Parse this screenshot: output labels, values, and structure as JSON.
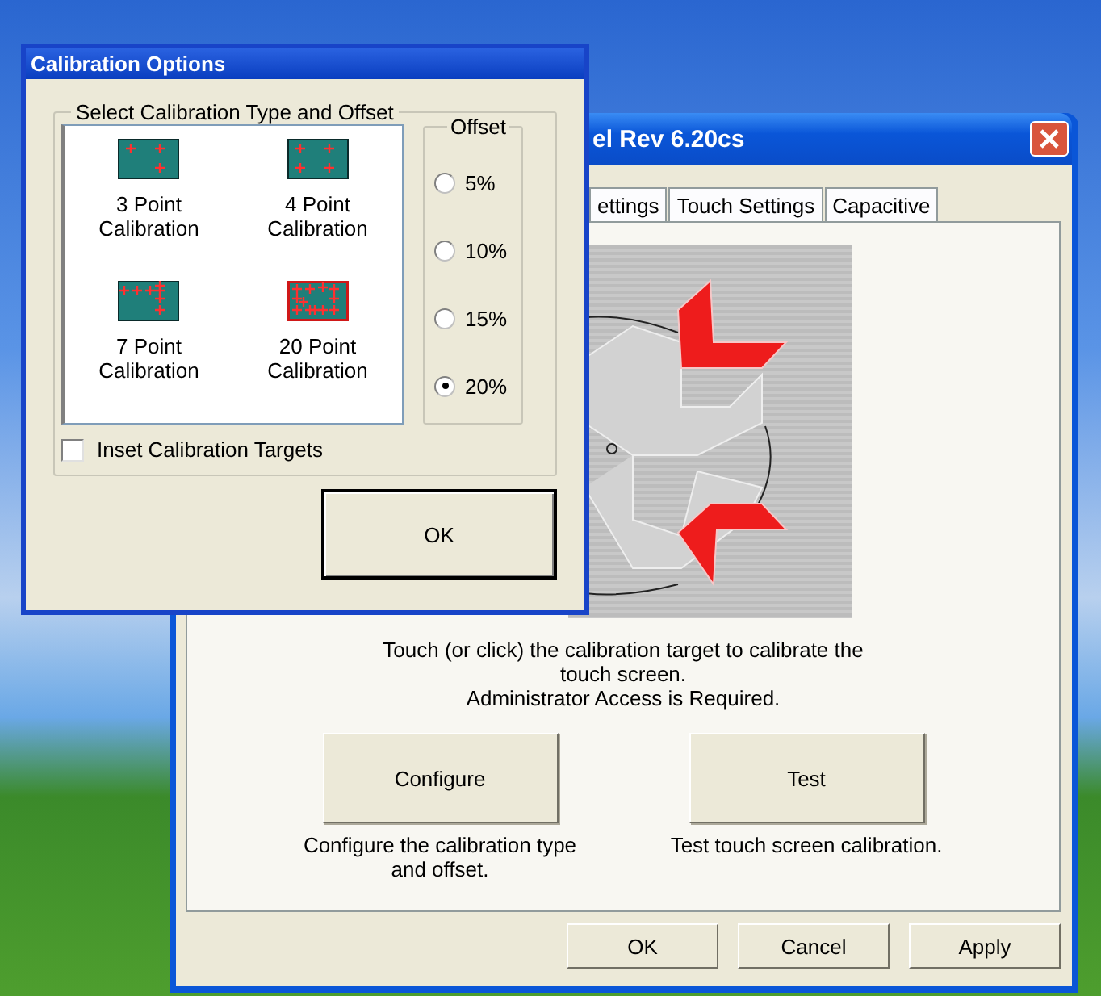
{
  "back_window": {
    "title": "el Rev 6.20cs",
    "tabs": [
      {
        "label": "ettings",
        "selected": false
      },
      {
        "label": "Touch Settings",
        "selected": false
      },
      {
        "label": "Capacitive",
        "selected": false
      }
    ],
    "instructions": [
      "Touch (or click) the calibration target to calibrate the touch screen.",
      "Administrator Access is Required."
    ],
    "actions": [
      {
        "label": "Configure",
        "caption": "Configure the calibration type and offset."
      },
      {
        "label": "Test",
        "caption": "Test touch screen calibration."
      }
    ],
    "buttons": [
      "OK",
      "Cancel",
      "Apply"
    ]
  },
  "calibration_dialog": {
    "title": "Calibration Options",
    "group_label": "Select Calibration Type and Offset",
    "types": [
      {
        "kind": "three",
        "label": "3 Point Calibration"
      },
      {
        "kind": "four",
        "label": "4 Point Calibration"
      },
      {
        "kind": "seven",
        "label": "7 Point Calibration"
      },
      {
        "kind": "twenty",
        "label": "20 Point Calibration"
      }
    ],
    "offset": {
      "label": "Offset",
      "options": [
        {
          "label": "5%",
          "selected": false
        },
        {
          "label": "10%",
          "selected": false
        },
        {
          "label": "15%",
          "selected": false
        },
        {
          "label": "20%",
          "selected": true
        }
      ]
    },
    "inset_targets": {
      "label": "Inset Calibration Targets",
      "checked": false
    },
    "ok": "OK"
  }
}
